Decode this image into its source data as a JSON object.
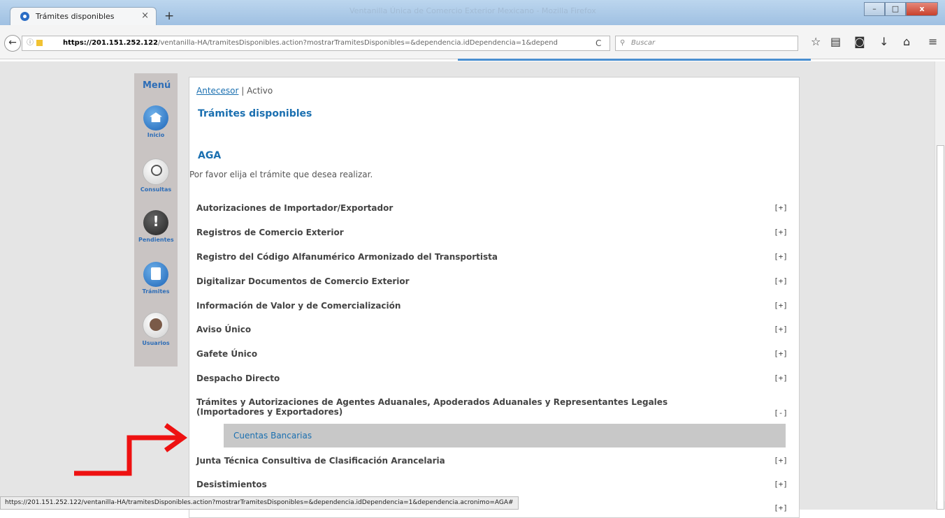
{
  "browser": {
    "tab_title": "Trámites disponibles",
    "tab_close": "×",
    "new_tab": "+",
    "window_title": "Ventanilla Única de Comercio Exterior Mexicano - Mozilla Firefox",
    "url_host": "https://201.151.252.122",
    "url_path": "/ventanilla-HA/tramitesDisponibles.action?mostrarTramitesDisponibles=&dependencia.idDependencia=1&depend",
    "search_placeholder": "Buscar",
    "status_url": "https://201.151.252.122/ventanilla-HA/tramitesDisponibles.action?mostrarTramitesDisponibles=&dependencia.idDependencia=1&dependencia.acronimo=AGA#"
  },
  "sidebar": {
    "title": "Menú",
    "items": [
      {
        "label": "Inicio"
      },
      {
        "label": "Consultas"
      },
      {
        "label": "Pendientes"
      },
      {
        "label": "Trámites"
      },
      {
        "label": "Usuarios"
      }
    ]
  },
  "content": {
    "breadcrumb_link": "Antecesor",
    "breadcrumb_sep": " | ",
    "breadcrumb_active": "Activo",
    "title": "Trámites disponibles",
    "section": "AGA",
    "intro": "Por favor elija el trámite que desea realizar.",
    "tramites": [
      {
        "label": "Autorizaciones de Importador/Exportador",
        "toggle": "[+]"
      },
      {
        "label": "Registros de Comercio Exterior",
        "toggle": "[+]"
      },
      {
        "label": "Registro del Código Alfanumérico Armonizado del Transportista",
        "toggle": "[+]"
      },
      {
        "label": "Digitalizar Documentos de Comercio Exterior",
        "toggle": "[+]"
      },
      {
        "label": "Información de Valor y de Comercialización",
        "toggle": "[+]"
      },
      {
        "label": "Aviso Único",
        "toggle": "[+]"
      },
      {
        "label": "Gafete Único",
        "toggle": "[+]"
      },
      {
        "label": "Despacho Directo",
        "toggle": "[+]"
      },
      {
        "label": "Trámites y Autorizaciones de Agentes Aduanales, Apoderados Aduanales y Representantes Legales (Importadores y Exportadores)",
        "toggle": "[-]"
      },
      {
        "label": "Junta Técnica Consultiva de Clasificación Arancelaria",
        "toggle": "[+]"
      },
      {
        "label": "Desistimientos",
        "toggle": "[+]"
      }
    ],
    "subitem": "Cuentas Bancarias",
    "last_toggle": "[+]"
  },
  "colors": {
    "link": "#1a6fb0",
    "annotation_arrow": "#ee1111"
  }
}
